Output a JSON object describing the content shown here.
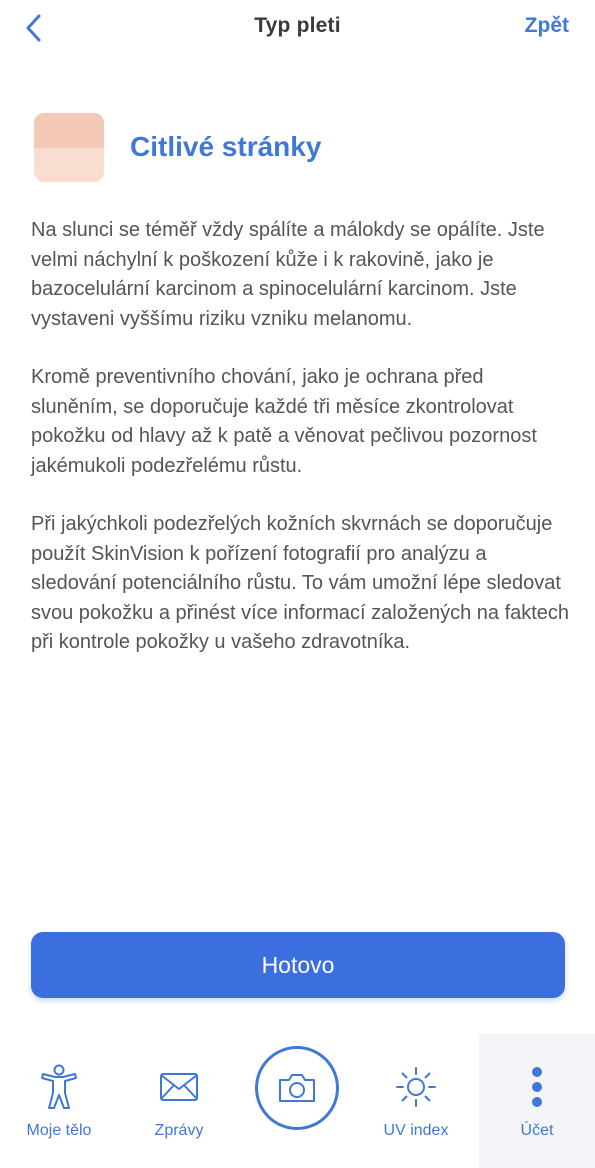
{
  "header": {
    "title": "Typ pleti",
    "action_label": "Zpět",
    "back_icon": "chevron-left-icon"
  },
  "skin_type": {
    "title": "Citlivé stránky",
    "swatch_colors": [
      "#f4c9b8",
      "#f9ddd0"
    ]
  },
  "paragraphs": [
    "Na slunci se téměř vždy spálíte a málokdy se opálíte. Jste velmi náchylní k poškození kůže i k rakovině, jako je bazocelulární karcinom a spinocelulární karcinom. Jste vystaveni vyššímu riziku vzniku melanomu.",
    "Kromě preventivního chování, jako je ochrana před sluněním, se doporučuje každé tři měsíce zkontrolovat pokožku od hlavy až k patě a věnovat pečlivou pozornost jakémukoli podezřelému růstu.",
    "Při jakýchkoli podezřelých kožních skvrnách se doporučuje použít SkinVision k pořízení fotografií pro analýzu a sledování potenciálního růstu. To vám umožní lépe sledovat svou pokožku a přinést více informací založených na faktech při kontrole pokožky u vašeho zdravotníka."
  ],
  "primary_button": {
    "label": "Hotovo"
  },
  "tabbar": {
    "tabs": [
      {
        "label": "Moje tělo",
        "icon": "body-icon"
      },
      {
        "label": "Zprávy",
        "icon": "envelope-icon"
      },
      {
        "label": "",
        "icon": "camera-icon"
      },
      {
        "label": "UV index",
        "icon": "sun-icon"
      },
      {
        "label": "Účet",
        "icon": "more-vertical-icon"
      }
    ]
  },
  "colors": {
    "accent": "#3f78d6",
    "button": "#3b6fdf",
    "body_text": "#555555",
    "title_text": "#3a3a3a",
    "active_tab_bg": "#f3f4f7"
  }
}
